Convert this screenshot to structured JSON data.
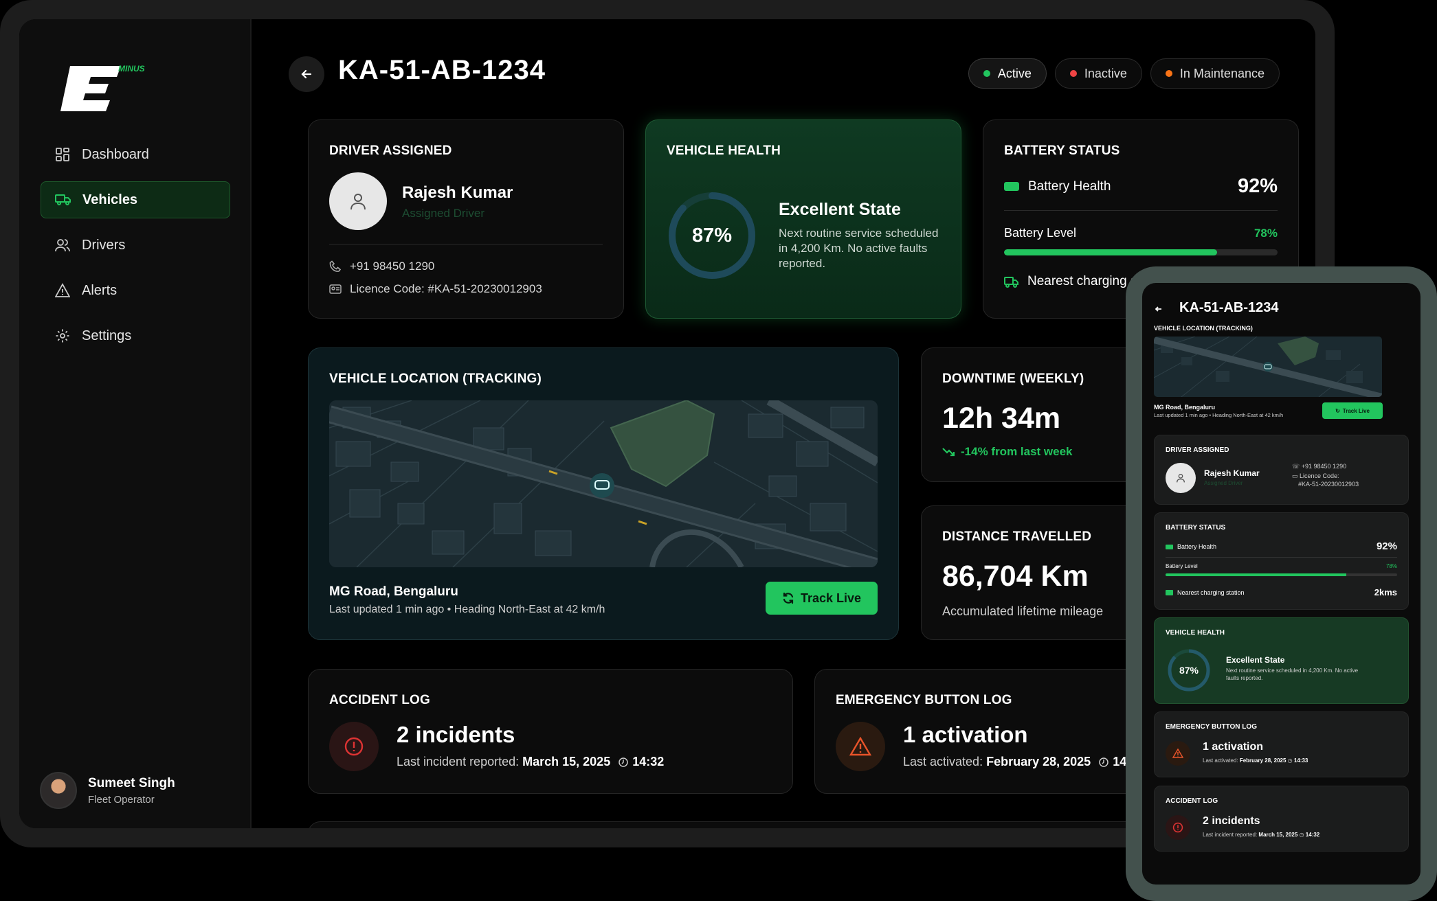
{
  "brand": {
    "sub": "MINUS"
  },
  "colors": {
    "accent": "#22c55e",
    "active_dot": "#22c55e",
    "inactive_dot": "#ef4444",
    "maintenance_dot": "#f97316"
  },
  "nav": [
    {
      "label": "Dashboard",
      "icon": "grid-icon"
    },
    {
      "label": "Vehicles",
      "icon": "truck-icon",
      "active": true
    },
    {
      "label": "Drivers",
      "icon": "users-icon"
    },
    {
      "label": "Alerts",
      "icon": "warning-icon"
    },
    {
      "label": "Settings",
      "icon": "gear-icon"
    }
  ],
  "user": {
    "name": "Sumeet Singh",
    "role": "Fleet Operator"
  },
  "header": {
    "title": "KA-51-AB-1234"
  },
  "status": {
    "active": "Active",
    "inactive": "Inactive",
    "maintenance": "In Maintenance",
    "selected": "Active"
  },
  "driver": {
    "heading": "DRIVER ASSIGNED",
    "name": "Rajesh Kumar",
    "role": "Assigned Driver",
    "phone": "+91 98450 1290",
    "licence": "Licence Code: #KA-51-20230012903"
  },
  "health": {
    "heading": "VEHICLE HEALTH",
    "percent": 87,
    "percent_label": "87%",
    "state": "Excellent State",
    "note": "Next routine service scheduled in 4,200 Km. No active faults reported."
  },
  "battery": {
    "heading": "BATTERY STATUS",
    "health_label": "Battery Health",
    "health_value": "92%",
    "level_label": "Battery Level",
    "level_value": "78%",
    "level": 78,
    "nearest_label": "Nearest charging st"
  },
  "location": {
    "heading": "VEHICLE LOCATION (TRACKING)",
    "place": "MG Road, Bengaluru",
    "updated": "Last updated 1 min ago • Heading North-East at 42 km/h",
    "button": "Track Live"
  },
  "downtime": {
    "heading": "DOWNTIME (WEEKLY)",
    "value": "12h 34m",
    "change": "-14% from last week"
  },
  "distance": {
    "heading": "DISTANCE TRAVELLED",
    "value": "86,704 Km",
    "note": "Accumulated lifetime mileage"
  },
  "accident": {
    "heading": "ACCIDENT LOG",
    "value": "2 incidents",
    "label": "Last incident reported:",
    "date": "March 15, 2025",
    "time": "14:32"
  },
  "emergency": {
    "heading": "EMERGENCY BUTTON LOG",
    "value": "1 activation",
    "label": "Last activated:",
    "date": "February 28, 2025",
    "time": "14:33"
  },
  "mobile": {
    "title": "KA-51-AB-1234",
    "location_heading": "VEHICLE LOCATION (TRACKING)",
    "place": "MG Road, Bengaluru",
    "updated": "Last updated 1 min ago • Heading North-East at 42 km/h",
    "button": "Track Live",
    "driver_heading": "DRIVER ASSIGNED",
    "driver_name": "Rajesh Kumar",
    "driver_role": "Assigned Driver",
    "phone": "+91 98450 1290",
    "licence_1": "Licence Code:",
    "licence_2": "#KA-51-20230012903",
    "battery_heading": "BATTERY STATUS",
    "battery_health_label": "Battery Health",
    "battery_health_value": "92%",
    "battery_level_label": "Battery Level",
    "battery_level_value": "78%",
    "nearest_label": "Nearest charging station",
    "nearest_value": "2kms",
    "health_heading": "VEHICLE HEALTH",
    "health_value": "87%",
    "health_state": "Excellent State",
    "health_note": "Next routine service scheduled in 4,200 Km. No active faults reported.",
    "emergency_heading": "EMERGENCY BUTTON LOG",
    "emergency_value": "1 activation",
    "emergency_label": "Last activated:",
    "emergency_date": "February 28, 2025",
    "emergency_time": "14:33",
    "accident_heading": "ACCIDENT LOG",
    "accident_value": "2 incidents",
    "accident_label": "Last incident reported:",
    "accident_date": "March 15, 2025",
    "accident_time": "14:32"
  }
}
